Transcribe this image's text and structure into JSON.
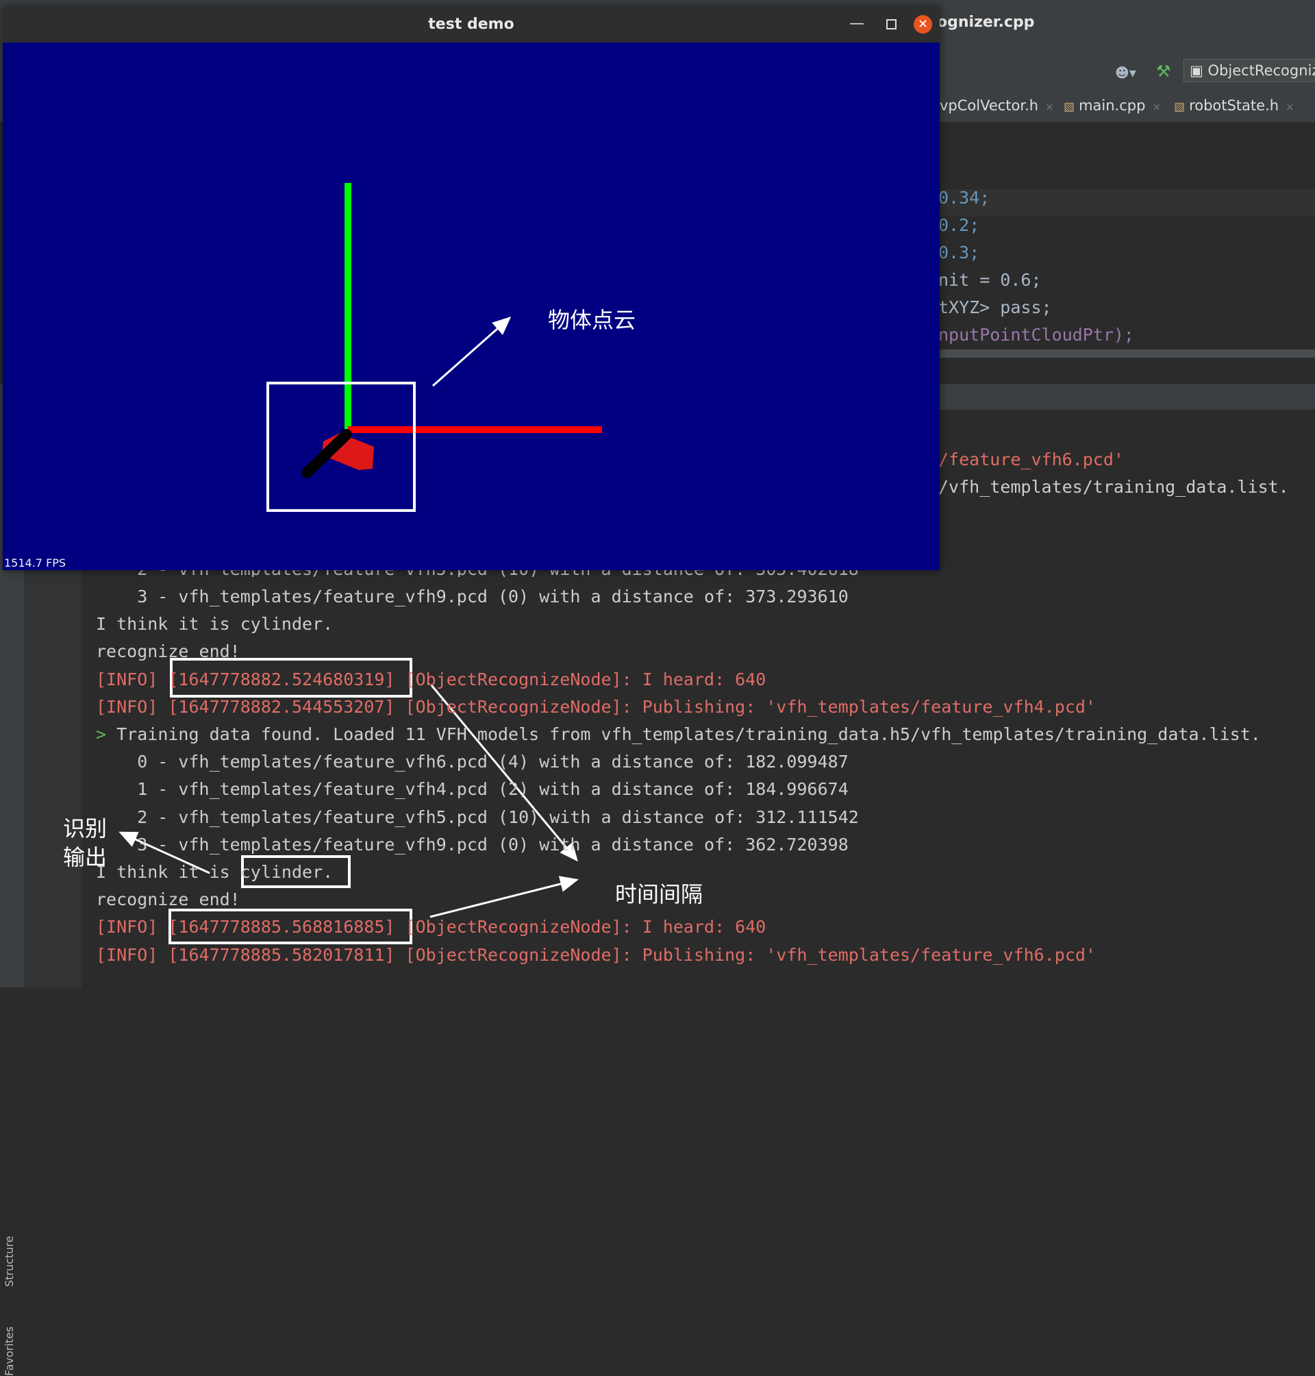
{
  "ide": {
    "title": "ognizer.cpp",
    "toolbar": {
      "run_config": "ObjectRecogniz"
    },
    "tabs": [
      {
        "label": "vpColVector.h"
      },
      {
        "label": "main.cpp"
      },
      {
        "label": "robotState.h"
      }
    ],
    "code_lines": [
      "0.34;",
      "0.2;",
      "0.3;",
      "nit = 0.6;",
      "tXYZ> pass;",
      "nputPointCloudPtr);"
    ],
    "console_upper": [
      "/feature_vfh6.pcd'",
      "/vfh_templates/training_data.list."
    ],
    "side_labels": {
      "structure": "Structure",
      "favorites": "Favorites"
    }
  },
  "console": {
    "lines": [
      {
        "text": "    3 - vfh_templates/feature_vfh9.pcd (0) with a distance of: 373.293610",
        "type": "normal"
      },
      {
        "text": "I think it is cylinder.",
        "type": "normal"
      },
      {
        "text": "recognize end!",
        "type": "normal"
      },
      {
        "text": "[INFO] [1647778882.524680319] [ObjectRecognizeNode]: I heard: 640",
        "type": "info"
      },
      {
        "text": "[INFO] [1647778882.544553207] [ObjectRecognizeNode]: Publishing: 'vfh_templates/feature_vfh4.pcd'",
        "type": "info"
      },
      {
        "text": "Training data found. Loaded 11 VFH models from vfh_templates/training_data.h5/vfh_templates/training_data.list.",
        "type": "prompt",
        "prefix": ">"
      },
      {
        "text": "    0 - vfh_templates/feature_vfh6.pcd (4) with a distance of: 182.099487",
        "type": "normal"
      },
      {
        "text": "    1 - vfh_templates/feature_vfh4.pcd (2) with a distance of: 184.996674",
        "type": "normal"
      },
      {
        "text": "    2 - vfh_templates/feature_vfh5.pcd (10) with a distance of: 312.111542",
        "type": "normal"
      },
      {
        "text": "    3 - vfh_templates/feature_vfh9.pcd (0) with a distance of: 362.720398",
        "type": "normal"
      },
      {
        "text": "I think it is cylinder.",
        "type": "normal"
      },
      {
        "text": "recognize end!",
        "type": "normal"
      },
      {
        "text": "[INFO] [1647778885.568816885] [ObjectRecognizeNode]: I heard: 640",
        "type": "info"
      },
      {
        "text": "[INFO] [1647778885.582017811] [ObjectRecognizeNode]: Publishing: 'vfh_templates/feature_vfh6.pcd'",
        "type": "info"
      }
    ],
    "partial_top_line": "    2 - vfh_templates/feature_vfh5.pcd (10) with a distance of: 305.402618"
  },
  "demo_window": {
    "title": "test demo",
    "fps": "1514.7 FPS",
    "background": "#000080",
    "axis_colors": {
      "x": "#ff0000",
      "y": "#00ff00"
    }
  },
  "annotations": {
    "object_cloud": "物体点云",
    "recog_output_line1": "识别",
    "recog_output_line2": "输出",
    "time_interval": "时间间隔"
  }
}
